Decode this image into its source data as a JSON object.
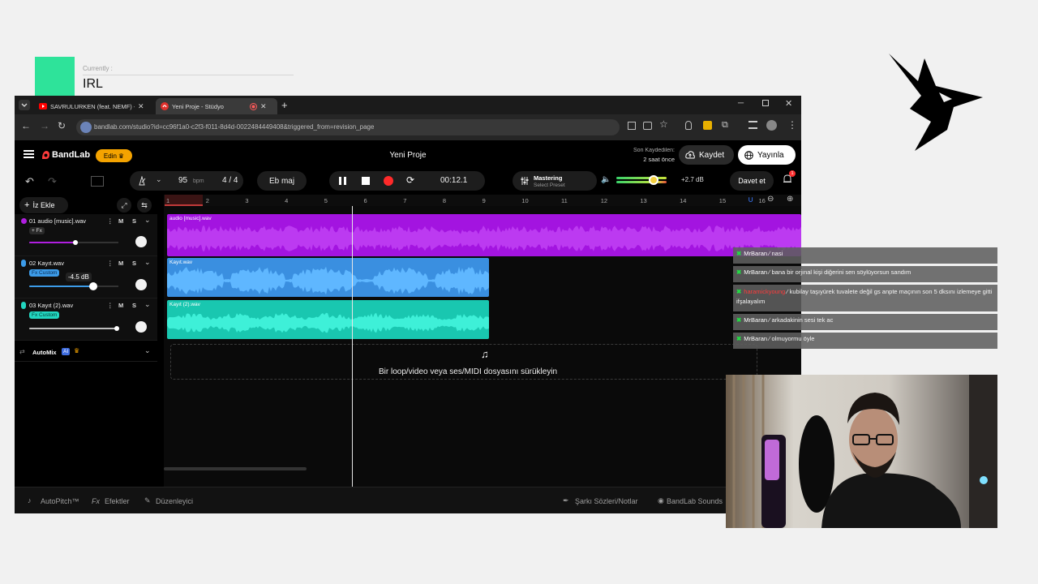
{
  "overlay": {
    "currently_label": "Currently :",
    "title": "IRL",
    "accent_color": "#2ee39a"
  },
  "browser": {
    "tabs": [
      {
        "title": "SAVRULURKEN (feat. NEMF) - Y",
        "icon": "youtube-icon",
        "active": false
      },
      {
        "title": "Yeni Proje - Stüdyo",
        "icon": "bandlab-icon",
        "active": true
      }
    ],
    "url": "bandlab.com/studio?id=cc96f1a0-c2f3-f011-8d4d-0022484449408&triggered_from=revision_page"
  },
  "app": {
    "brand": "BandLab",
    "edit_badge": "Edin",
    "project_title": "Yeni Proje",
    "saved_label": "Son Kaydedilen:",
    "saved_time": "2 saat önce",
    "save_button": "Kaydet",
    "publish_button": "Yayınla",
    "accent_color": "#ff3c3c"
  },
  "toolbar": {
    "tempo": "95",
    "bpm_label": "bpm",
    "time_signature": "4 / 4",
    "key": "Eb maj",
    "position": "00:12.1",
    "mastering_title": "Mastering",
    "mastering_preset": "Select Preset",
    "volume_db": "+2.7 dB",
    "invite_button": "Davet et",
    "notification_count": "1"
  },
  "tracks_panel": {
    "add_track": "İz Ekle",
    "tracks": [
      {
        "name": "01  audio [music].wav",
        "fx": "+ Fx",
        "color": "#b01ee0",
        "volume": 0.52
      },
      {
        "name": "02  Kayıt.wav",
        "fx": "Fx Custom",
        "color": "#3c9be8",
        "volume": 0.72,
        "tooltip": "-4.5 dB"
      },
      {
        "name": "03  Kayıt (2).wav",
        "fx": "Fx Custom",
        "color": "#22d6c0",
        "volume": 0.98
      }
    ],
    "mute": "M",
    "solo": "S",
    "automix": "AutoMix",
    "automix_badge": "AI"
  },
  "ruler": {
    "ticks": [
      "1",
      "2",
      "3",
      "4",
      "5",
      "6",
      "7",
      "8",
      "9",
      "10",
      "11",
      "12",
      "13",
      "14",
      "15",
      "16"
    ]
  },
  "timeline": {
    "regions": [
      {
        "label": "audio [music].wav",
        "color": "#a314e0",
        "start": 0.0,
        "end": 1.0
      },
      {
        "label": "Kayıt.wav",
        "color": "#3a8fe0",
        "start": 0.0,
        "end": 0.51
      },
      {
        "label": "Kayıt (2).wav",
        "color": "#19c7b0",
        "start": 0.0,
        "end": 0.51
      }
    ],
    "drop_text": "Bir loop/video veya ses/MIDI dosyasını sürükleyin"
  },
  "bottom_bar": {
    "autopitch": "AutoPitch™",
    "effects_prefix": "Fx",
    "effects": "Efektler",
    "editor": "Düzenleyici",
    "lyrics": "Şarkı Sözleri/Notlar",
    "sounds": "BandLab Sounds"
  },
  "chat": [
    {
      "user": "MrBaran",
      "message": "nasi",
      "highlight": false
    },
    {
      "user": "MrBaran",
      "message": "bana bir orjınal kişi diğerini sen söylüyorsun sandım",
      "highlight": false
    },
    {
      "user": "haramickyoung",
      "message": "kubilay taşıyürek tuvalete değil gs anpte maçının son 5 dksını izlemeye gitti ifşalayalım",
      "highlight": true
    },
    {
      "user": "MrBaran",
      "message": "arkadakinin sesi tek ac",
      "highlight": false
    },
    {
      "user": "MrBaran",
      "message": "olmuyormu öyle",
      "highlight": false
    }
  ]
}
